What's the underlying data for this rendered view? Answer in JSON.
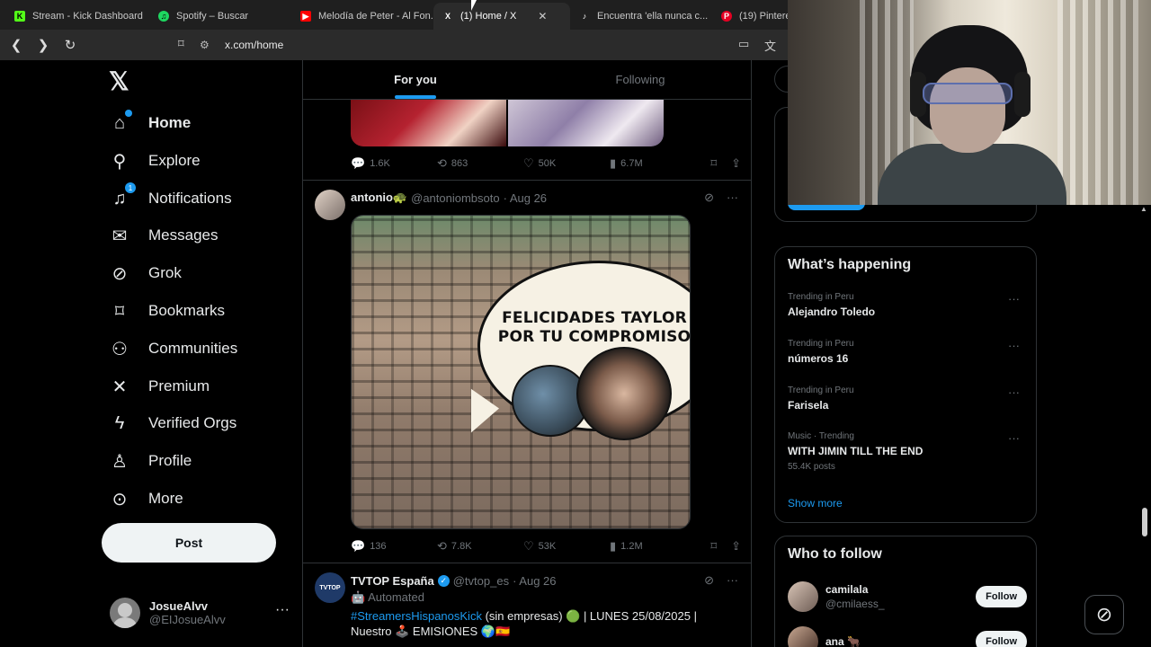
{
  "browser": {
    "tabs": [
      {
        "label": "Stream - Kick Dashboard",
        "fav": "K",
        "color": "#53fc18"
      },
      {
        "label": "Spotify – Buscar",
        "fav": "♫",
        "color": "#1ed760"
      },
      {
        "label": "Melodía de Peter - Al Fon...",
        "fav": "▶",
        "color": "#ff0000"
      },
      {
        "label": "(1) Home / X",
        "fav": "X",
        "color": "#ffffff"
      },
      {
        "label": "Encuentra 'ella nunca c...",
        "fav": "♪",
        "color": "#ffffff"
      },
      {
        "label": "(19) Pinterest",
        "fav": "P",
        "color": "#e60023"
      }
    ],
    "url": "x.com/home"
  },
  "sidebar": {
    "nav": [
      {
        "label": "Home",
        "icon": "home-icon",
        "glyph": "⌂"
      },
      {
        "label": "Explore",
        "icon": "search-icon",
        "glyph": "⌕"
      },
      {
        "label": "Notifications",
        "icon": "bell-icon",
        "glyph": "🔔",
        "badge": "1"
      },
      {
        "label": "Messages",
        "icon": "mail-icon",
        "glyph": "✉"
      },
      {
        "label": "Grok",
        "icon": "grok-icon",
        "glyph": "⊘"
      },
      {
        "label": "Bookmarks",
        "icon": "bookmark-icon",
        "glyph": "⌑"
      },
      {
        "label": "Communities",
        "icon": "communities-icon",
        "glyph": "⚇"
      },
      {
        "label": "Premium",
        "icon": "x-premium-icon",
        "glyph": "✕"
      },
      {
        "label": "Verified Orgs",
        "icon": "lightning-icon",
        "glyph": "ϟ"
      },
      {
        "label": "Profile",
        "icon": "person-icon",
        "glyph": "⍝"
      },
      {
        "label": "More",
        "icon": "more-circle-icon",
        "glyph": "⊙"
      }
    ],
    "post_label": "Post",
    "account": {
      "name": "JosueAlvv",
      "handle": "@EIJosueAlvv"
    }
  },
  "feed": {
    "tabs": [
      "For you",
      "Following"
    ],
    "tweet1_stats": {
      "replies": "1.6K",
      "reposts": "863",
      "likes": "50K",
      "views": "6.7M"
    },
    "tweet2": {
      "name": "antonio🐢",
      "handle": "@antoniombsoto",
      "date": "· Aug 26",
      "image_text_1": "FELICIDADES TAYLOR",
      "image_text_2": "POR TU COMPROMISO",
      "stats": {
        "replies": "136",
        "reposts": "7.8K",
        "likes": "53K",
        "views": "1.2M"
      }
    },
    "tweet3": {
      "name": "TVTOP España",
      "avatar_label": "TVTOP",
      "handle": "@tvtop_es",
      "date": "· Aug 26",
      "automated": "Automated",
      "hashtag": "#StreamersHispanosKick",
      "text_1": " (sin empresas)  🟢 | LUNES 25/08/2025 |",
      "text_2": "Nuestro 🕹️ EMISIONES 🌍🇪🇸"
    }
  },
  "right": {
    "happening_title": "What’s happening",
    "trends": [
      {
        "meta": "Trending in Peru",
        "name": "Alejandro Toledo",
        "posts": ""
      },
      {
        "meta": "Trending in Peru",
        "name": "números 16",
        "posts": ""
      },
      {
        "meta": "Trending in Peru",
        "name": "Farisela",
        "posts": ""
      },
      {
        "meta": "Music · Trending",
        "name": "WITH JIMIN TILL THE END",
        "posts": "55.4K posts"
      }
    ],
    "show_more": "Show more",
    "wtf_title": "Who to follow",
    "follow": [
      {
        "name": "camilala",
        "handle": "@cmilaess_",
        "button": "Follow"
      },
      {
        "name": "ana 🐂",
        "handle": "",
        "button": "Follow"
      }
    ]
  }
}
